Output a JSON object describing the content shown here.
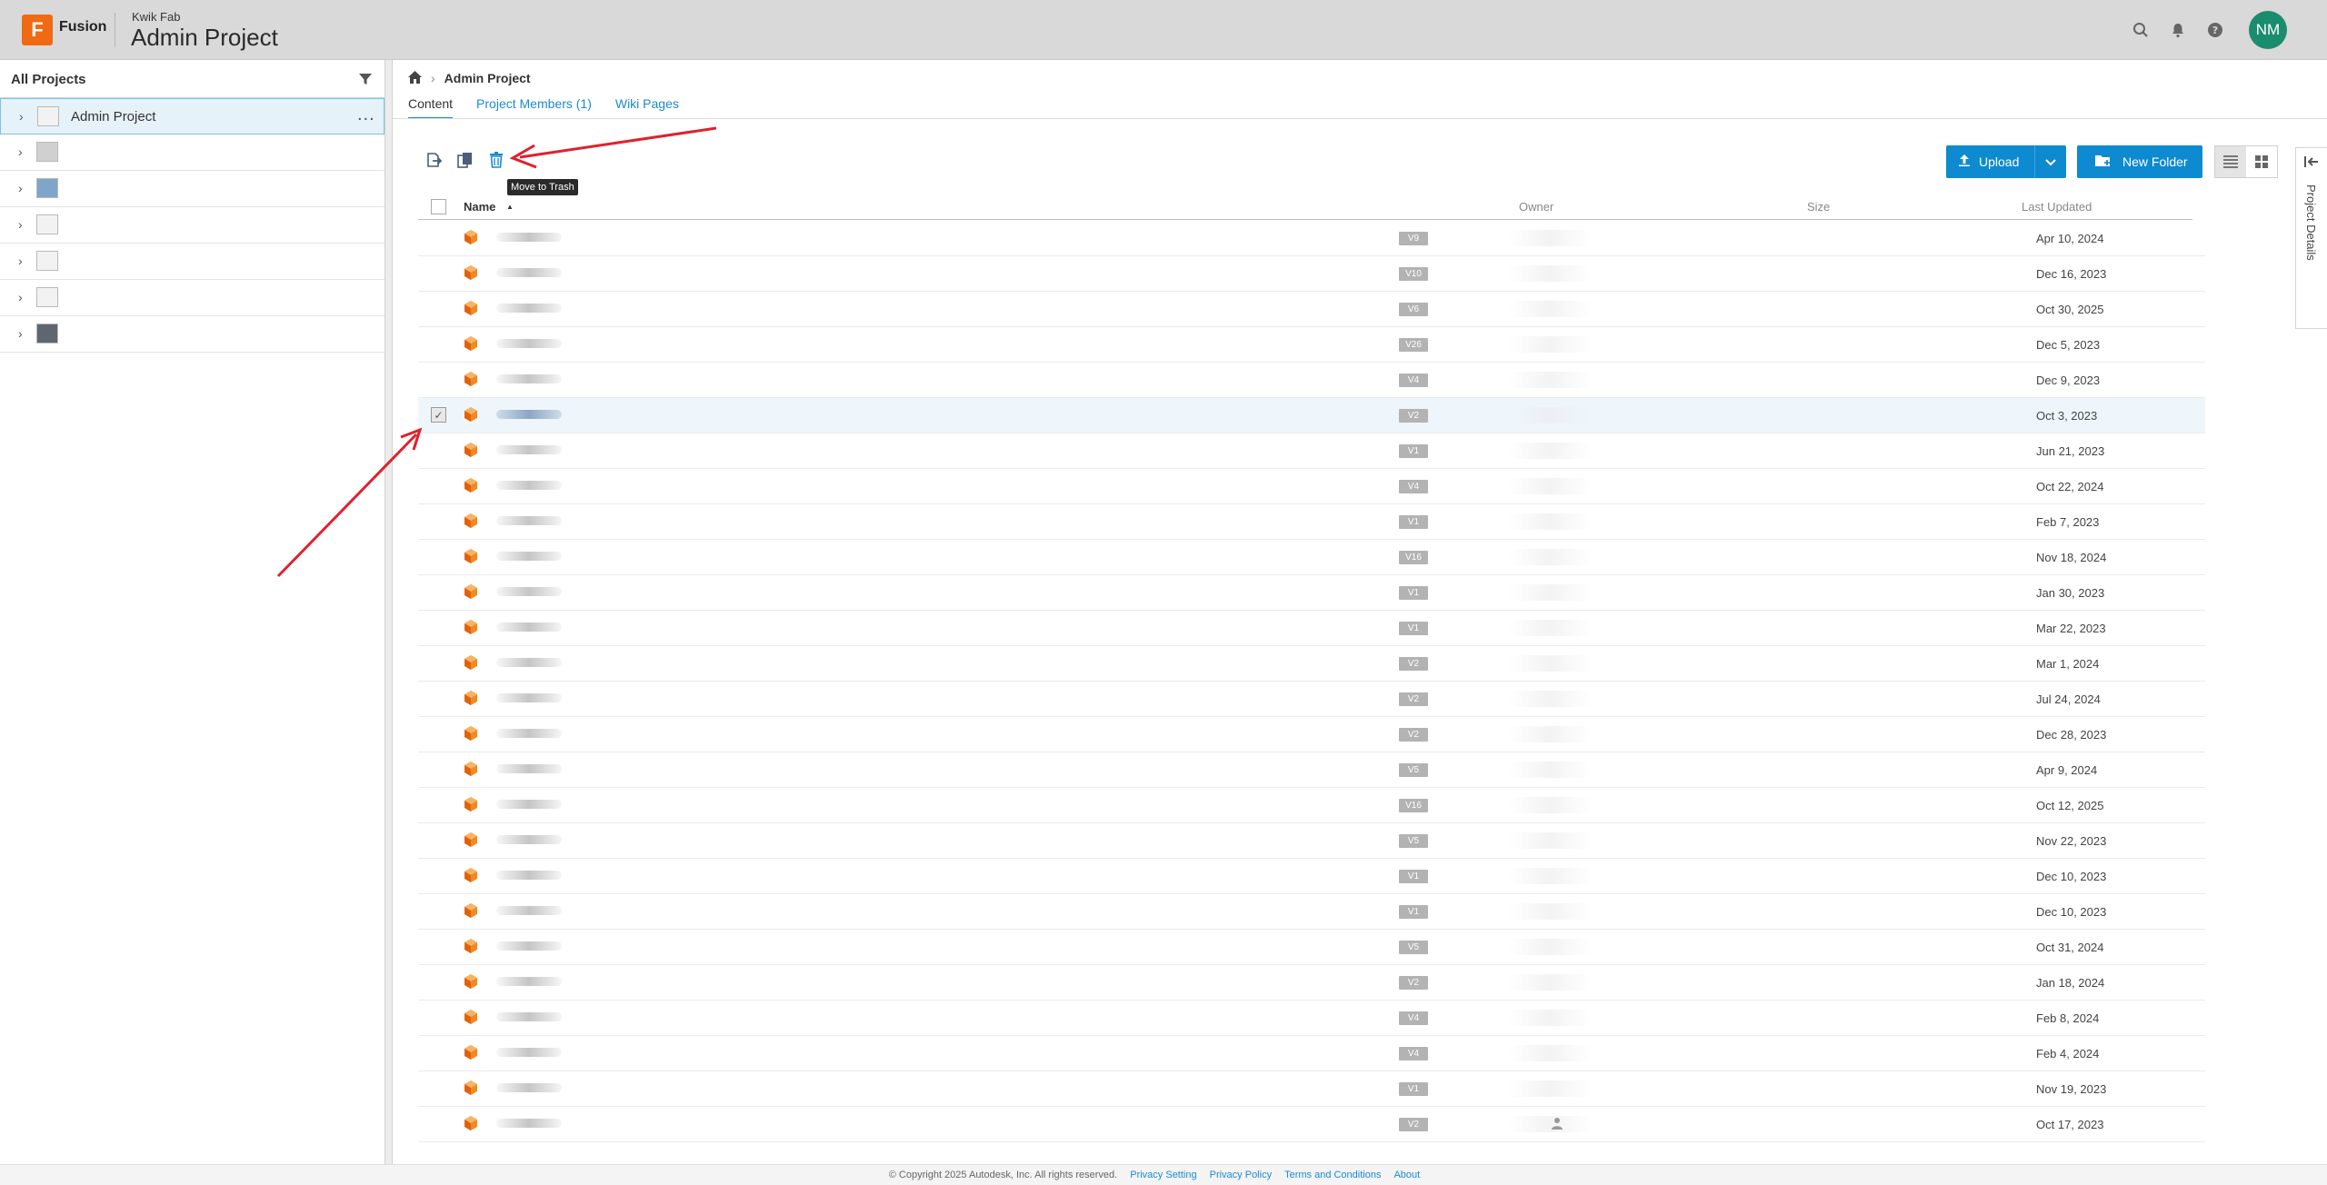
{
  "header": {
    "logo_letter": "F",
    "app_name": "Fusion",
    "hub_name": "Kwik Fab",
    "project_title": "Admin Project",
    "user_initials": "NM",
    "icons": [
      "search-icon",
      "bell-icon",
      "help-icon"
    ]
  },
  "left_panel": {
    "title": "All Projects",
    "items": [
      {
        "label": "Admin Project",
        "selected": true,
        "more": "..."
      },
      {
        "label": ""
      },
      {
        "label": ""
      },
      {
        "label": ""
      },
      {
        "label": ""
      },
      {
        "label": ""
      },
      {
        "label": ""
      }
    ]
  },
  "breadcrumb": {
    "current": "Admin Project"
  },
  "tabs": [
    {
      "label": "Content",
      "active": true
    },
    {
      "label": "Project Members (1)",
      "active": false
    },
    {
      "label": "Wiki Pages",
      "active": false
    }
  ],
  "toolbar": {
    "tooltip": "Move to Trash",
    "upload_label": "Upload",
    "new_folder_label": "New Folder",
    "details_tab_label": "Project Details"
  },
  "table": {
    "columns": {
      "name": "Name",
      "sort_indicator": "▲",
      "owner": "Owner",
      "size": "Size",
      "last_updated": "Last Updated"
    },
    "rows": [
      {
        "version": "V9",
        "date": "Apr 10, 2024",
        "checked": false
      },
      {
        "version": "V10",
        "date": "Dec 16, 2023",
        "checked": false
      },
      {
        "version": "V6",
        "date": "Oct 30, 2025",
        "checked": false
      },
      {
        "version": "V26",
        "date": "Dec 5, 2023",
        "checked": false
      },
      {
        "version": "V4",
        "date": "Dec 9, 2023",
        "checked": false
      },
      {
        "version": "V2",
        "date": "Oct 3, 2023",
        "checked": true
      },
      {
        "version": "V1",
        "date": "Jun 21, 2023",
        "checked": false
      },
      {
        "version": "V4",
        "date": "Oct 22, 2024",
        "checked": false
      },
      {
        "version": "V1",
        "date": "Feb 7, 2023",
        "checked": false
      },
      {
        "version": "V16",
        "date": "Nov 18, 2024",
        "checked": false
      },
      {
        "version": "V1",
        "date": "Jan 30, 2023",
        "checked": false
      },
      {
        "version": "V1",
        "date": "Mar 22, 2023",
        "checked": false
      },
      {
        "version": "V2",
        "date": "Mar 1, 2024",
        "checked": false
      },
      {
        "version": "V2",
        "date": "Jul 24, 2024",
        "checked": false
      },
      {
        "version": "V2",
        "date": "Dec 28, 2023",
        "checked": false
      },
      {
        "version": "V5",
        "date": "Apr 9, 2024",
        "checked": false
      },
      {
        "version": "V16",
        "date": "Oct 12, 2025",
        "checked": false
      },
      {
        "version": "V5",
        "date": "Nov 22, 2023",
        "checked": false
      },
      {
        "version": "V1",
        "date": "Dec 10, 2023",
        "checked": false
      },
      {
        "version": "V1",
        "date": "Dec 10, 2023",
        "checked": false
      },
      {
        "version": "V5",
        "date": "Oct 31, 2024",
        "checked": false
      },
      {
        "version": "V2",
        "date": "Jan 18, 2024",
        "checked": false
      },
      {
        "version": "V4",
        "date": "Feb 8, 2024",
        "checked": false
      },
      {
        "version": "V4",
        "date": "Feb 4, 2024",
        "checked": false
      },
      {
        "version": "V1",
        "date": "Nov 19, 2023",
        "checked": false
      },
      {
        "version": "V2",
        "date": "Oct 17, 2023",
        "checked": false
      }
    ]
  },
  "footer": {
    "copyright": "© Copyright 2025 Autodesk, Inc. All rights reserved.",
    "links": [
      "Privacy Setting",
      "Privacy Policy",
      "Terms and Conditions",
      "About"
    ]
  },
  "colors": {
    "accent": "#0e8ad0",
    "brand_orange": "#f06a13",
    "avatar": "#1a8d6e",
    "annotation_arrow": "#e0202e"
  }
}
